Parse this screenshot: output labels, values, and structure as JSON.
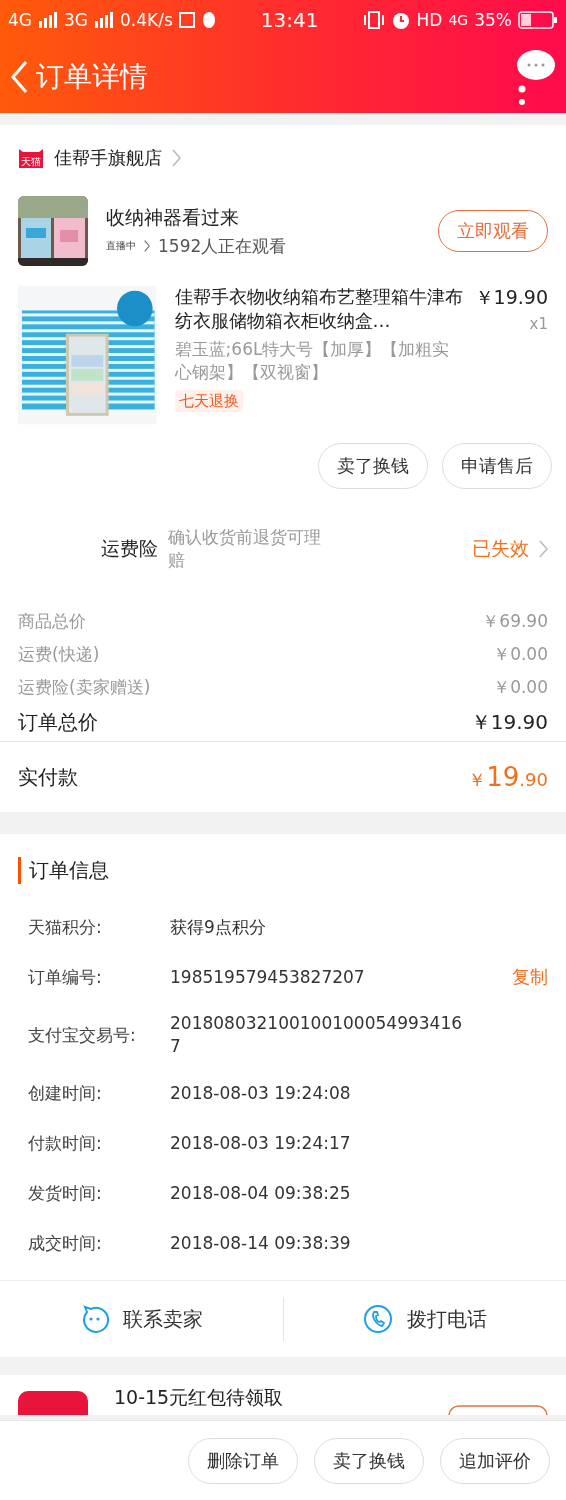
{
  "status_bar": {
    "network_1": "4G",
    "network_2": "3G",
    "speed": "0.4K/s",
    "time": "13:41",
    "hd": "HD",
    "network_3": "4G",
    "battery": "35%"
  },
  "header": {
    "title": "订单详情"
  },
  "store": {
    "name": "佳帮手旗舰店",
    "badge": "天猫"
  },
  "live": {
    "title": "收纳神器看过来",
    "status": "直播中",
    "viewers": "1592人正在观看",
    "button": "立即观看"
  },
  "product": {
    "title": "佳帮手衣物收纳箱布艺整理箱牛津布纺衣服储物箱衣柜收纳盒…",
    "price": "￥19.90",
    "quantity": "x1",
    "sku": "碧玉蓝;66L特大号【加厚】【加粗实心钢架】【双视窗】",
    "tag": "七天退换",
    "buttons": [
      "卖了换钱",
      "申请售后"
    ]
  },
  "insurance": {
    "label": "运费险",
    "description": "确认收货前退货可理赔",
    "status": "已失效"
  },
  "price_rows": [
    {
      "label": "商品总价",
      "value": "￥69.90"
    },
    {
      "label": "运费(快递)",
      "value": "￥0.00"
    },
    {
      "label": "运费险(卖家赠送)",
      "value": "￥0.00"
    }
  ],
  "order_total": {
    "label": "订单总价",
    "value": "￥19.90"
  },
  "paid": {
    "label": "实付款",
    "currency": "￥",
    "integer": "19",
    "decimal": ".90"
  },
  "order_info": {
    "title": "订单信息",
    "rows": [
      {
        "label": "天猫积分:",
        "value": "获得9点积分"
      },
      {
        "label": "订单编号:",
        "value": "198519579453827207",
        "action": "复制"
      },
      {
        "label": "支付宝交易号:",
        "value": "2018080321001001000549934167"
      },
      {
        "label": "创建时间:",
        "value": "2018-08-03 19:24:08"
      },
      {
        "label": "付款时间:",
        "value": "2018-08-03 19:24:17"
      },
      {
        "label": "发货时间:",
        "value": "2018-08-04 09:38:25"
      },
      {
        "label": "成交时间:",
        "value": "2018-08-14 09:38:39"
      }
    ]
  },
  "contact": [
    {
      "kind": "chat",
      "label": "联系卖家"
    },
    {
      "kind": "phone",
      "label": "拨打电话"
    }
  ],
  "promo": {
    "text": "10-15元红包待领取"
  },
  "bottom_buttons": [
    "删除订单",
    "卖了换钱",
    "追加评价"
  ]
}
